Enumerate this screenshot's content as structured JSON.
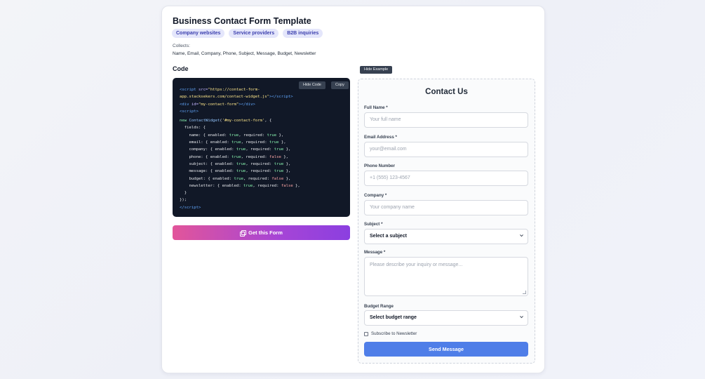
{
  "template": {
    "title": "Business Contact Form Template",
    "tags": [
      "Company websites",
      "Service providers",
      "B2B inquiries"
    ],
    "collects_label": "Collects:",
    "collects_value": "Name, Email, Company, Phone, Subject, Message, Budget, Newsletter",
    "code_heading": "Code",
    "hide_code_label": "Hide Code",
    "copy_label": "Copy",
    "get_form_label": "Get this Form",
    "hide_example_label": "Hide Example"
  },
  "code": {
    "script_src": "\"https://contact-form-",
    "script_src2": "app.stacksekers.com/contact-widget.js\"",
    "div_id": "\"my-contact-form\"",
    "selector": "'#my-contact-form'",
    "fields": [
      {
        "name": "name",
        "enabled": "true",
        "required": "true"
      },
      {
        "name": "email",
        "enabled": "true",
        "required": "true"
      },
      {
        "name": "company",
        "enabled": "true",
        "required": "true"
      },
      {
        "name": "phone",
        "enabled": "true",
        "required": "false"
      },
      {
        "name": "subject",
        "enabled": "true",
        "required": "true"
      },
      {
        "name": "message",
        "enabled": "true",
        "required": "true"
      },
      {
        "name": "budget",
        "enabled": "true",
        "required": "false"
      },
      {
        "name": "newsletter",
        "enabled": "true",
        "required": "false"
      }
    ]
  },
  "form": {
    "title": "Contact Us",
    "full_name_label": "Full Name *",
    "full_name_placeholder": "Your full name",
    "email_label": "Email Address *",
    "email_placeholder": "your@email.com",
    "phone_label": "Phone Number",
    "phone_placeholder": "+1 (555) 123-4567",
    "company_label": "Company *",
    "company_placeholder": "Your company name",
    "subject_label": "Subject *",
    "subject_value": "Select a subject",
    "message_label": "Message *",
    "message_placeholder": "Please describe your inquiry or message...",
    "budget_label": "Budget Range",
    "budget_value": "Select budget range",
    "newsletter_label": "Subscribe to Newsletter",
    "send_label": "Send Message"
  }
}
